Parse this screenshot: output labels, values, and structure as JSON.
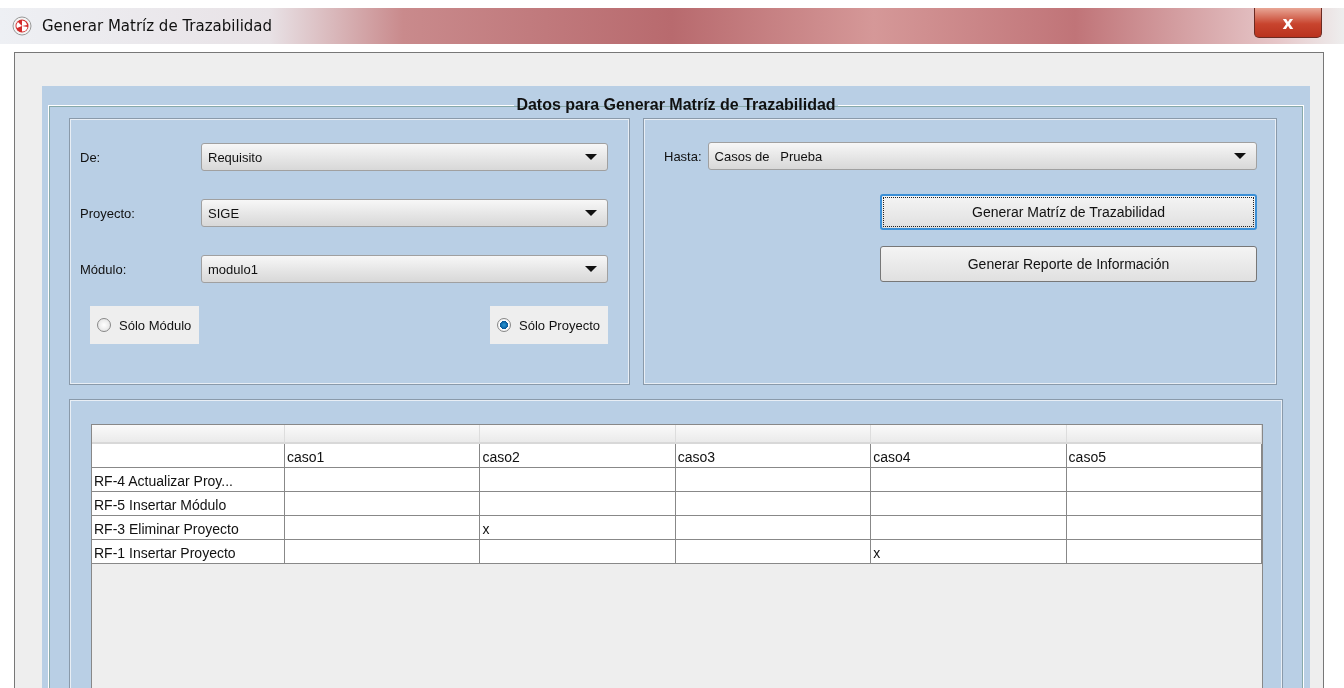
{
  "window": {
    "title": "Generar Matríz de Trazabilidad",
    "close_label": "x"
  },
  "panel": {
    "legend": "Datos para Generar Matríz de Trazabilidad"
  },
  "from_fields": [
    {
      "label": "De:",
      "value": "Requisito"
    },
    {
      "label": "Proyecto:",
      "value": "SIGE"
    },
    {
      "label": "Módulo:",
      "value": "modulo1"
    }
  ],
  "scope_options": [
    {
      "label": "Sólo Módulo",
      "selected": false
    },
    {
      "label": "Sólo Proyecto",
      "selected": true
    }
  ],
  "to_field": {
    "label": "Hasta:",
    "value": "Casos de   Prueba"
  },
  "buttons": [
    {
      "label": "Generar Matríz de Trazabilidad",
      "focused": true
    },
    {
      "label": "Generar Reporte de Información",
      "focused": false
    }
  ],
  "table": {
    "rows": [
      [
        "",
        "caso1",
        "caso2",
        "caso3",
        "caso4",
        "caso5"
      ],
      [
        "RF-4 Actualizar Proy...",
        "",
        "",
        "",
        "",
        ""
      ],
      [
        "RF-5 Insertar Módulo",
        "",
        "",
        "",
        "",
        ""
      ],
      [
        "RF-3 Eliminar Proyecto",
        "",
        "x",
        "",
        "",
        ""
      ],
      [
        "RF-1 Insertar Proyecto",
        "",
        "",
        "",
        "x",
        ""
      ]
    ]
  }
}
